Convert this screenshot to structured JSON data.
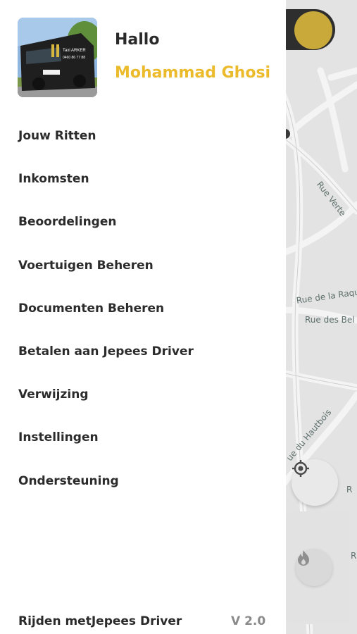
{
  "drawer": {
    "greeting": "Hallo",
    "user_name": "Mohammad Ghosi",
    "menu_items": [
      "Jouw Ritten",
      "Inkomsten",
      "Beoordelingen",
      "Voertuigen Beheren",
      "Documenten Beheren",
      "Betalen aan Jepees Driver",
      "Verwijzing",
      "Instellingen",
      "Ondersteuning"
    ],
    "footer_text": "Rijden metJepees Driver",
    "version": "V 2.0"
  },
  "avatar": {
    "van_sign_title": "Taxi ARKER",
    "van_sign_phone": "0460 86 77 88"
  },
  "map": {
    "street_labels": [
      "Rue Verte",
      "Rue de la Raqu",
      "Rue des Bel",
      "ue du Hautbois",
      "R",
      "R"
    ]
  },
  "colors": {
    "accent": "#ecbb2c",
    "text": "#2b2b2b",
    "muted": "#8a8a8a",
    "map_bg": "#e3e3e3"
  },
  "icons": {
    "locate": "crosshair-icon",
    "hotspot": "flame-icon"
  }
}
